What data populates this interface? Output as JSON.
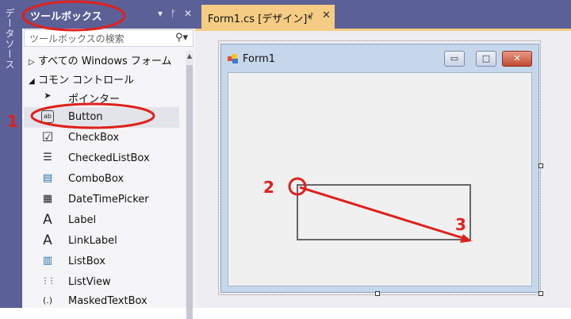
{
  "side_strip": {
    "label": "データソース"
  },
  "toolbox": {
    "title": "ツールボックス",
    "header_icons": [
      "▾",
      "ᚠ",
      "✕"
    ],
    "search": {
      "placeholder": "ツールボックスの検索",
      "icon": "search-icon"
    },
    "categories": [
      {
        "label": "すべての Windows フォーム",
        "expanded": false
      },
      {
        "label": "コモン コントロール",
        "expanded": true
      }
    ],
    "items": [
      {
        "label": "ポインター",
        "icon": "pointer-icon",
        "glyph": "➤"
      },
      {
        "label": "Button",
        "icon": "button-icon",
        "glyph": "ab"
      },
      {
        "label": "CheckBox",
        "icon": "checkbox-icon",
        "glyph": "☑"
      },
      {
        "label": "CheckedListBox",
        "icon": "checkedlistbox-icon",
        "glyph": "☰"
      },
      {
        "label": "ComboBox",
        "icon": "combobox-icon",
        "glyph": "▤"
      },
      {
        "label": "DateTimePicker",
        "icon": "datetimepicker-icon",
        "glyph": "▦"
      },
      {
        "label": "Label",
        "icon": "label-icon",
        "glyph": "A"
      },
      {
        "label": "LinkLabel",
        "icon": "linklabel-icon",
        "glyph": "A"
      },
      {
        "label": "ListBox",
        "icon": "listbox-icon",
        "glyph": "▥"
      },
      {
        "label": "ListView",
        "icon": "listview-icon",
        "glyph": "⋮⋮"
      },
      {
        "label": "MaskedTextBox",
        "icon": "maskedtextbox-icon",
        "glyph": "(.)"
      }
    ],
    "selected_item": "Button"
  },
  "tab": {
    "label": "Form1.cs [デザイン]*",
    "pin": "ᚠ",
    "close": "✕"
  },
  "form": {
    "title": "Form1",
    "buttons": {
      "minimize": "▭",
      "maximize": "□",
      "close": "✕"
    }
  },
  "annotations": {
    "step1": "1",
    "step2": "2",
    "step3": "3",
    "color": "#e0201b"
  },
  "colors": {
    "header": "#5b6096",
    "active_tab": "#f5cc84",
    "annotation": "#e0201b"
  }
}
